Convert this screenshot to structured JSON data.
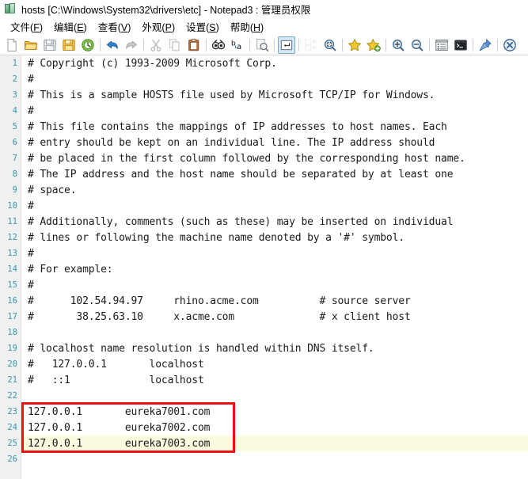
{
  "window": {
    "title": "hosts [C:\\Windows\\System32\\drivers\\etc] - Notepad3 : 管理员权限",
    "app_icon": "notepad3-icon"
  },
  "menubar": {
    "items": [
      {
        "name": "file",
        "label": "文件",
        "accel": "F"
      },
      {
        "name": "edit",
        "label": "编辑",
        "accel": "E"
      },
      {
        "name": "view",
        "label": "查看",
        "accel": "V"
      },
      {
        "name": "appearance",
        "label": "外观",
        "accel": "P"
      },
      {
        "name": "settings",
        "label": "设置",
        "accel": "S"
      },
      {
        "name": "help",
        "label": "帮助",
        "accel": "H"
      }
    ]
  },
  "toolbar": {
    "items": [
      {
        "type": "button",
        "name": "new-file-icon"
      },
      {
        "type": "button",
        "name": "open-file-icon"
      },
      {
        "type": "button",
        "name": "save-icon"
      },
      {
        "type": "button",
        "name": "save-as-icon"
      },
      {
        "type": "button",
        "name": "revert-file-icon"
      },
      {
        "type": "sep",
        "name": "separator-1"
      },
      {
        "type": "button",
        "name": "undo-icon"
      },
      {
        "type": "button",
        "name": "redo-icon"
      },
      {
        "type": "sep",
        "name": "separator-2"
      },
      {
        "type": "button",
        "name": "cut-icon"
      },
      {
        "type": "button",
        "name": "copy-icon"
      },
      {
        "type": "button",
        "name": "paste-icon"
      },
      {
        "type": "sep",
        "name": "separator-3"
      },
      {
        "type": "button",
        "name": "find-icon"
      },
      {
        "type": "button",
        "name": "replace-icon"
      },
      {
        "type": "sep",
        "name": "separator-4"
      },
      {
        "type": "button",
        "name": "find-next-icon"
      },
      {
        "type": "sep",
        "name": "separator-5"
      },
      {
        "type": "button",
        "name": "show-whitespace-eol-icon",
        "active": true
      },
      {
        "type": "sep",
        "name": "separator-6"
      },
      {
        "type": "button",
        "name": "word-wrap-icon",
        "disabled": true
      },
      {
        "type": "button",
        "name": "zoom-selection-icon"
      },
      {
        "type": "sep",
        "name": "separator-7"
      },
      {
        "type": "button",
        "name": "bookmark-icon"
      },
      {
        "type": "button",
        "name": "add-bookmark-icon"
      },
      {
        "type": "sep",
        "name": "separator-8"
      },
      {
        "type": "button",
        "name": "zoom-in-icon"
      },
      {
        "type": "button",
        "name": "zoom-out-icon"
      },
      {
        "type": "sep",
        "name": "separator-9"
      },
      {
        "type": "button",
        "name": "schemes-icon"
      },
      {
        "type": "button",
        "name": "console-icon"
      },
      {
        "type": "sep",
        "name": "separator-10"
      },
      {
        "type": "button",
        "name": "always-on-top-pin-icon"
      },
      {
        "type": "sep",
        "name": "separator-11"
      },
      {
        "type": "button",
        "name": "exit-icon"
      }
    ]
  },
  "editor": {
    "colors": {
      "gutter_bg": "#f0f0f0",
      "line_number": "#3a96a8",
      "text": "#1a1a1a",
      "current_line_highlight": "#fcfadf",
      "annotation_box": "#ee1111"
    },
    "highlighted_line": 25,
    "annotation": {
      "name": "red-highlight-box",
      "from_line": 23,
      "to_line": 25
    },
    "lines": [
      {
        "n": 1,
        "text": "# Copyright (c) 1993-2009 Microsoft Corp."
      },
      {
        "n": 2,
        "text": "#"
      },
      {
        "n": 3,
        "text": "# This is a sample HOSTS file used by Microsoft TCP/IP for Windows."
      },
      {
        "n": 4,
        "text": "#"
      },
      {
        "n": 5,
        "text": "# This file contains the mappings of IP addresses to host names. Each"
      },
      {
        "n": 6,
        "text": "# entry should be kept on an individual line. The IP address should"
      },
      {
        "n": 7,
        "text": "# be placed in the first column followed by the corresponding host name."
      },
      {
        "n": 8,
        "text": "# The IP address and the host name should be separated by at least one"
      },
      {
        "n": 9,
        "text": "# space."
      },
      {
        "n": 10,
        "text": "#"
      },
      {
        "n": 11,
        "text": "# Additionally, comments (such as these) may be inserted on individual"
      },
      {
        "n": 12,
        "text": "# lines or following the machine name denoted by a '#' symbol."
      },
      {
        "n": 13,
        "text": "#"
      },
      {
        "n": 14,
        "text": "# For example:"
      },
      {
        "n": 15,
        "text": "#"
      },
      {
        "n": 16,
        "text": "#      102.54.94.97     rhino.acme.com          # source server"
      },
      {
        "n": 17,
        "text": "#       38.25.63.10     x.acme.com              # x client host"
      },
      {
        "n": 18,
        "text": ""
      },
      {
        "n": 19,
        "text": "# localhost name resolution is handled within DNS itself."
      },
      {
        "n": 20,
        "text": "#   127.0.0.1       localhost"
      },
      {
        "n": 21,
        "text": "#   ::1             localhost"
      },
      {
        "n": 22,
        "text": ""
      },
      {
        "n": 23,
        "text": "127.0.0.1       eureka7001.com"
      },
      {
        "n": 24,
        "text": "127.0.0.1       eureka7002.com"
      },
      {
        "n": 25,
        "text": "127.0.0.1       eureka7003.com"
      },
      {
        "n": 26,
        "text": ""
      }
    ]
  }
}
